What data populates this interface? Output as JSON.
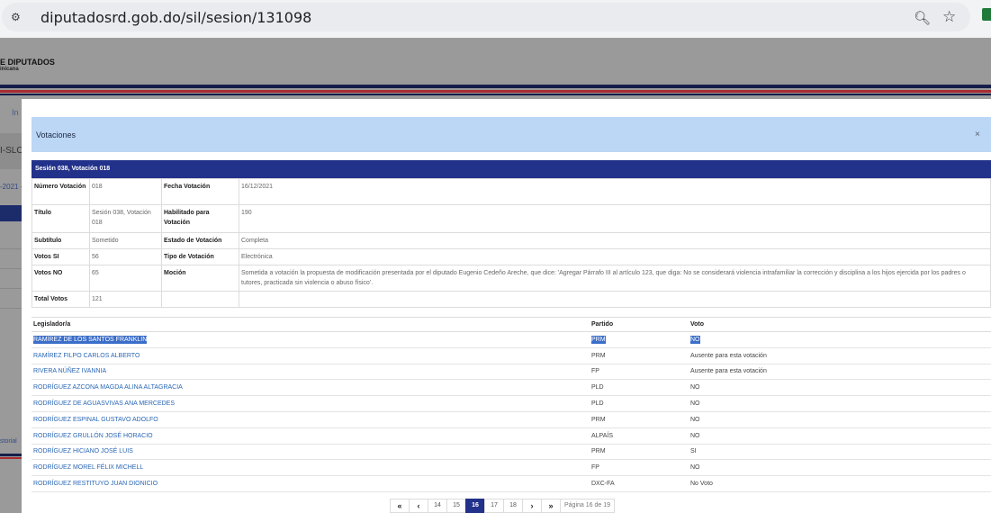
{
  "browser": {
    "url": "diputadosrd.gob.do/sil/sesion/131098"
  },
  "page": {
    "logo_title": "E DIPUTADOS",
    "logo_subtitle": "inicana",
    "side_link": "In",
    "side_code": "I-SLO",
    "side_date": "-2021 -",
    "side_history": "storial"
  },
  "modal": {
    "title": "Votaciones",
    "close": "×",
    "session_title": "Sesión 038, Votación 018",
    "info": {
      "numero_label": "Número Votación",
      "numero_value": "018",
      "fecha_label": "Fecha Votación",
      "fecha_value": "16/12/2021",
      "titulo_label": "Título",
      "titulo_value": "Sesión 038, Votación 018",
      "habilitado_label": "Habilitado para Votación",
      "habilitado_value": "190",
      "subtitulo_label": "Subtítulo",
      "subtitulo_value": "Sometido",
      "estado_label": "Estado de Votación",
      "estado_value": "Completa",
      "si_label": "Votos SI",
      "si_value": "56",
      "tipo_label": "Tipo de Votación",
      "tipo_value": "Electrónica",
      "no_label": "Votos NO",
      "no_value": "65",
      "mocion_label": "Moción",
      "mocion_value": "Sometida a votación la propuesta de modificación presentada por el diputado Eugenio Cedeño Areche, que dice: 'Agregar Párrafo III al artículo 123, que diga: No se considerará violencia intrafamiliar la corrección y disciplina a los hijos ejercida por los padres o tutores, practicada sin violencia o abuso físico'.",
      "total_label": "Total Votos",
      "total_value": "121"
    },
    "list": {
      "headers": {
        "legislador": "Legislador/a",
        "partido": "Partido",
        "voto": "Voto"
      },
      "rows": [
        {
          "name": "RAMÍREZ DE LOS SANTOS FRANKLIN",
          "party": "PRM",
          "vote": "NO"
        },
        {
          "name": "RAMÍREZ FILPO CARLOS ALBERTO",
          "party": "PRM",
          "vote": "Ausente para esta votación"
        },
        {
          "name": "RIVERA NÚÑEZ IVANNIA",
          "party": "FP",
          "vote": "Ausente para esta votación"
        },
        {
          "name": "RODRÍGUEZ AZCONA MAGDA ALINA ALTAGRACIA",
          "party": "PLD",
          "vote": "NO"
        },
        {
          "name": "RODRÍGUEZ DE AGUASVIVAS ANA MERCEDES",
          "party": "PLD",
          "vote": "NO"
        },
        {
          "name": "RODRÍGUEZ ESPINAL GUSTAVO ADOLFO",
          "party": "PRM",
          "vote": "NO"
        },
        {
          "name": "RODRÍGUEZ GRULLÓN JOSÉ HORACIO",
          "party": "ALPAÍS",
          "vote": "NO"
        },
        {
          "name": "RODRÍGUEZ HICIANO JOSÉ LUIS",
          "party": "PRM",
          "vote": "SI"
        },
        {
          "name": "RODRÍGUEZ MOREL FÉLIX MICHELL",
          "party": "FP",
          "vote": "NO"
        },
        {
          "name": "RODRÍGUEZ RESTITUYO JUAN DIONICIO",
          "party": "DXC-FA",
          "vote": "No Voto"
        }
      ]
    },
    "pager": {
      "first": "«",
      "prev": "‹",
      "pages": [
        "14",
        "15",
        "16",
        "17",
        "18"
      ],
      "next": "›",
      "last": "»",
      "info": "Página 16 de 19"
    }
  },
  "colors": {
    "header_bar": "#22318a",
    "modal_header": "#bcd6f5",
    "link": "#2a67b5",
    "highlight": "#3b6ec9"
  }
}
